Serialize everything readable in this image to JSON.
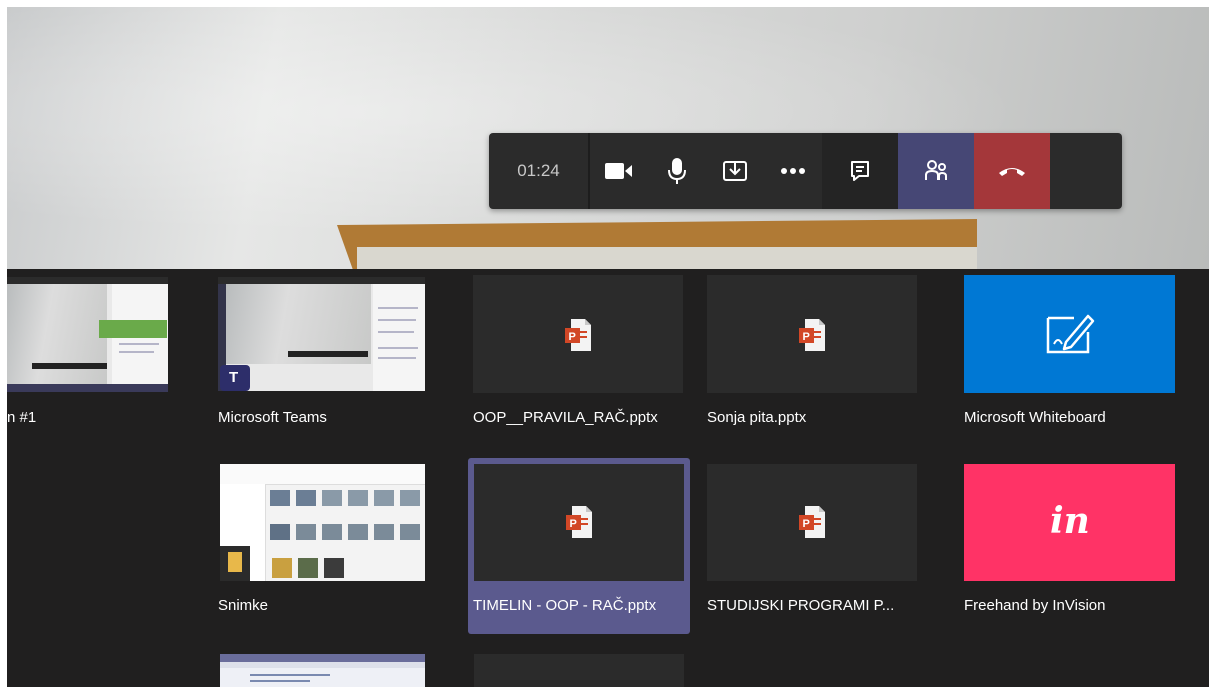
{
  "call": {
    "timer": "01:24",
    "controls": [
      {
        "name": "camera",
        "icon": "video-camera-icon"
      },
      {
        "name": "mute",
        "icon": "microphone-icon"
      },
      {
        "name": "share",
        "icon": "share-tray-icon"
      },
      {
        "name": "more",
        "icon": "more-actions-icon"
      },
      {
        "name": "chat",
        "icon": "chat-icon"
      },
      {
        "name": "participants",
        "icon": "people-icon"
      },
      {
        "name": "hang-up",
        "icon": "hang-up-icon"
      }
    ],
    "colors": {
      "participants_active": "#464775",
      "hangup": "#a4373a",
      "tray_bg": "#201f1f",
      "selected": "#5b5a8e"
    }
  },
  "tray": {
    "tiles": [
      {
        "label": "n #1",
        "kind": "window"
      },
      {
        "label": "Microsoft Teams",
        "kind": "window"
      },
      {
        "label": "OOP__PRAVILA_RAČ.pptx",
        "kind": "powerpoint"
      },
      {
        "label": "Sonja pita.pptx",
        "kind": "powerpoint"
      },
      {
        "label": "Microsoft Whiteboard",
        "kind": "whiteboard"
      },
      {
        "label": "Snimke",
        "kind": "window"
      },
      {
        "label": "TIMELIN - OOP - RAČ.pptx",
        "kind": "powerpoint",
        "selected": true
      },
      {
        "label": "STUDIJSKI PROGRAMI P...",
        "kind": "powerpoint"
      },
      {
        "label": "Freehand by InVision",
        "kind": "invision"
      }
    ],
    "invision_logo_text": "in"
  }
}
